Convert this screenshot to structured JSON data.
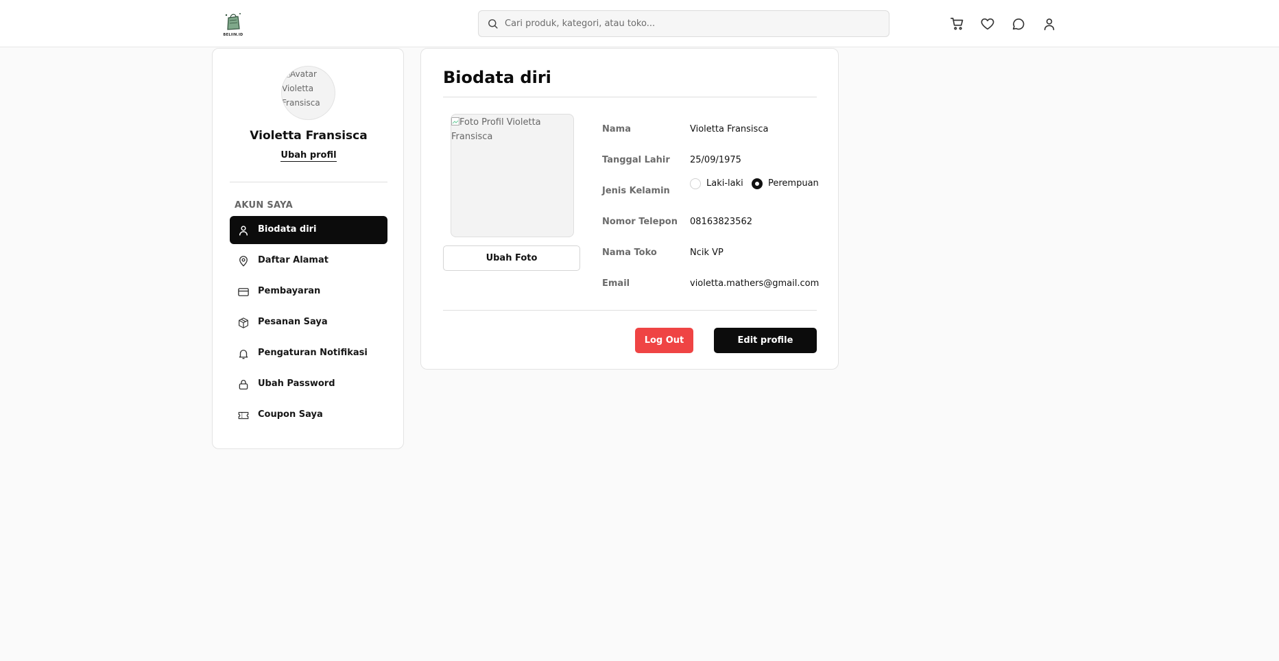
{
  "header": {
    "logo_text": "BELIIN.ID",
    "search_placeholder": "Cari produk, kategori, atau toko...",
    "icons": [
      "cart-icon",
      "heart-icon",
      "chat-icon",
      "user-icon"
    ]
  },
  "sidebar": {
    "avatar_alt": "Avatar Violetta Fransisca",
    "user_name": "Violetta Fransisca",
    "edit_profile_link": "Ubah profil",
    "section_title": "AKUN SAYA",
    "items": [
      {
        "label": "Biodata diri",
        "icon": "user-icon",
        "active": true
      },
      {
        "label": "Daftar Alamat",
        "icon": "map-pin-icon",
        "active": false
      },
      {
        "label": "Pembayaran",
        "icon": "credit-card-icon",
        "active": false
      },
      {
        "label": "Pesanan Saya",
        "icon": "package-icon",
        "active": false
      },
      {
        "label": "Pengaturan Notifikasi",
        "icon": "bell-icon",
        "active": false
      },
      {
        "label": "Ubah Password",
        "icon": "lock-icon",
        "active": false
      },
      {
        "label": "Coupon Saya",
        "icon": "ticket-icon",
        "active": false
      }
    ]
  },
  "main": {
    "title": "Biodata diri",
    "photo_alt": "Foto Profil Violetta Fransisca",
    "change_photo_button": "Ubah Foto",
    "fields": {
      "name_label": "Nama",
      "name_value": "Violetta Fransisca",
      "dob_label": "Tanggal Lahir",
      "dob_value": "25/09/1975",
      "gender_label": "Jenis Kelamin",
      "gender_options": [
        "Laki-laki",
        "Perempuan"
      ],
      "gender_selected": "Perempuan",
      "phone_label": "Nomor Telepon",
      "phone_value": "08163823562",
      "store_label": "Nama Toko",
      "store_value": "Ncik VP",
      "email_label": "Email",
      "email_value": "violetta.mathers@gmail.com"
    },
    "logout_button": "Log Out",
    "edit_button": "Edit profile"
  },
  "colors": {
    "accent": "#0c0c0c",
    "danger": "#ef4444",
    "background": "#fafafa"
  }
}
